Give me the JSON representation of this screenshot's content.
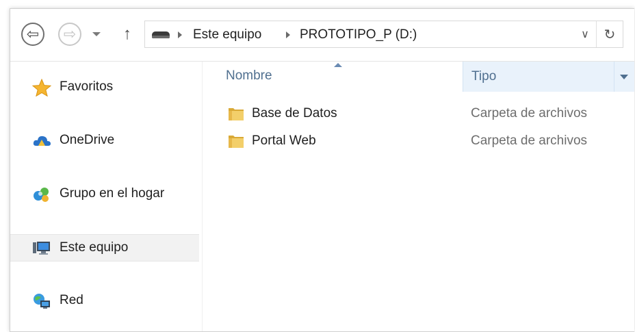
{
  "addressbar": {
    "back_glyph": "⇦",
    "forward_glyph": "⇨",
    "up_glyph": "↑",
    "refresh_glyph": "↻",
    "dropdown_glyph": "∨",
    "breadcrumbs": [
      "Este equipo",
      "PROTOTIPO_P (D:)"
    ]
  },
  "navpane": {
    "items": [
      {
        "label": "Favoritos",
        "icon": "star-icon"
      },
      {
        "label": "OneDrive",
        "icon": "onedrive-icon"
      },
      {
        "label": "Grupo en el hogar",
        "icon": "homegroup-icon"
      },
      {
        "label": "Este equipo",
        "icon": "computer-icon",
        "selected": true
      },
      {
        "label": "Red",
        "icon": "network-icon"
      }
    ]
  },
  "filelist": {
    "columns": {
      "name": "Nombre",
      "type": "Tipo"
    },
    "rows": [
      {
        "name": "Base de Datos",
        "type": "Carpeta de archivos"
      },
      {
        "name": "Portal Web",
        "type": "Carpeta de archivos"
      }
    ]
  },
  "colors": {
    "header_bg": "#e9f2fb",
    "header_text": "#4f6f8f",
    "folder": "#e8c35a"
  }
}
